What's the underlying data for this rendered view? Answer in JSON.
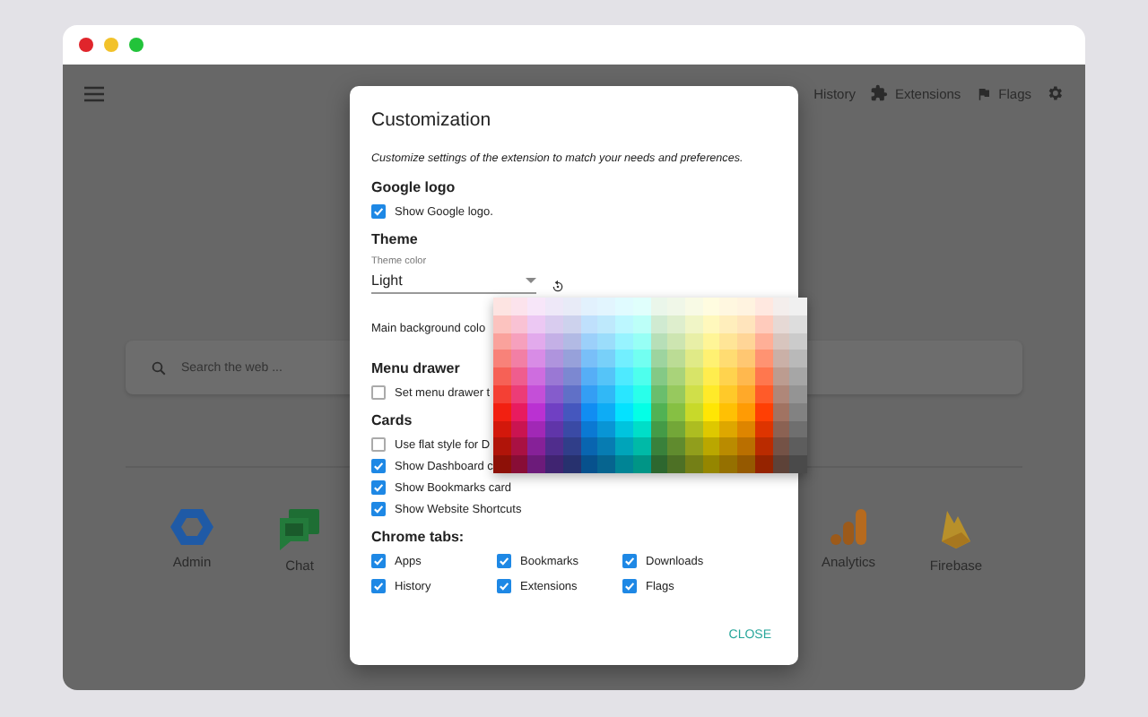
{
  "nav": {
    "items": [
      {
        "label": "History",
        "kind": "text"
      },
      {
        "label": "Extensions",
        "kind": "puzzle"
      },
      {
        "label": "Flags",
        "kind": "flag"
      }
    ]
  },
  "search": {
    "placeholder": "Search the web ..."
  },
  "apps": [
    {
      "label": "Admin",
      "kind": "hexagon"
    },
    {
      "label": "Chat",
      "kind": "chat"
    },
    {
      "label": "Analytics",
      "kind": "bars"
    },
    {
      "label": "Firebase",
      "kind": "flame"
    }
  ],
  "dialog": {
    "title": "Customization",
    "description": "Customize settings of the extension to match your needs and preferences.",
    "sections": [
      {
        "heading": "Google logo",
        "kind": "list",
        "items": [
          {
            "kind": "checkbox",
            "label": "Show Google logo.",
            "checked": true
          }
        ]
      },
      {
        "heading": "Theme",
        "kind": "list",
        "items": [
          {
            "kind": "select",
            "label": "Theme color",
            "value": "Light"
          },
          {
            "kind": "color",
            "label": "Main background colo",
            "expanded": true
          }
        ]
      },
      {
        "heading": "Menu drawer",
        "kind": "list",
        "items": [
          {
            "kind": "checkbox",
            "label": "Set menu drawer t",
            "checked": false
          }
        ]
      },
      {
        "heading": "Cards",
        "kind": "list",
        "items": [
          {
            "kind": "checkbox",
            "label": "Use flat style for D",
            "checked": false
          },
          {
            "kind": "checkbox",
            "label": "Show Dashboard c",
            "checked": true
          },
          {
            "kind": "checkbox",
            "label": "Show Bookmarks card",
            "checked": true
          },
          {
            "kind": "checkbox",
            "label": "Show Website Shortcuts",
            "checked": true
          }
        ]
      },
      {
        "heading": "Chrome tabs:",
        "kind": "grid",
        "items": [
          {
            "kind": "checkbox",
            "label": "Apps",
            "checked": true
          },
          {
            "kind": "checkbox",
            "label": "Bookmarks",
            "checked": true
          },
          {
            "kind": "checkbox",
            "label": "Downloads",
            "checked": true
          },
          {
            "kind": "checkbox",
            "label": "History",
            "checked": true
          },
          {
            "kind": "checkbox",
            "label": "Extensions",
            "checked": true
          },
          {
            "kind": "checkbox",
            "label": "Flags",
            "checked": true
          }
        ]
      }
    ],
    "close_button": "CLOSE"
  }
}
